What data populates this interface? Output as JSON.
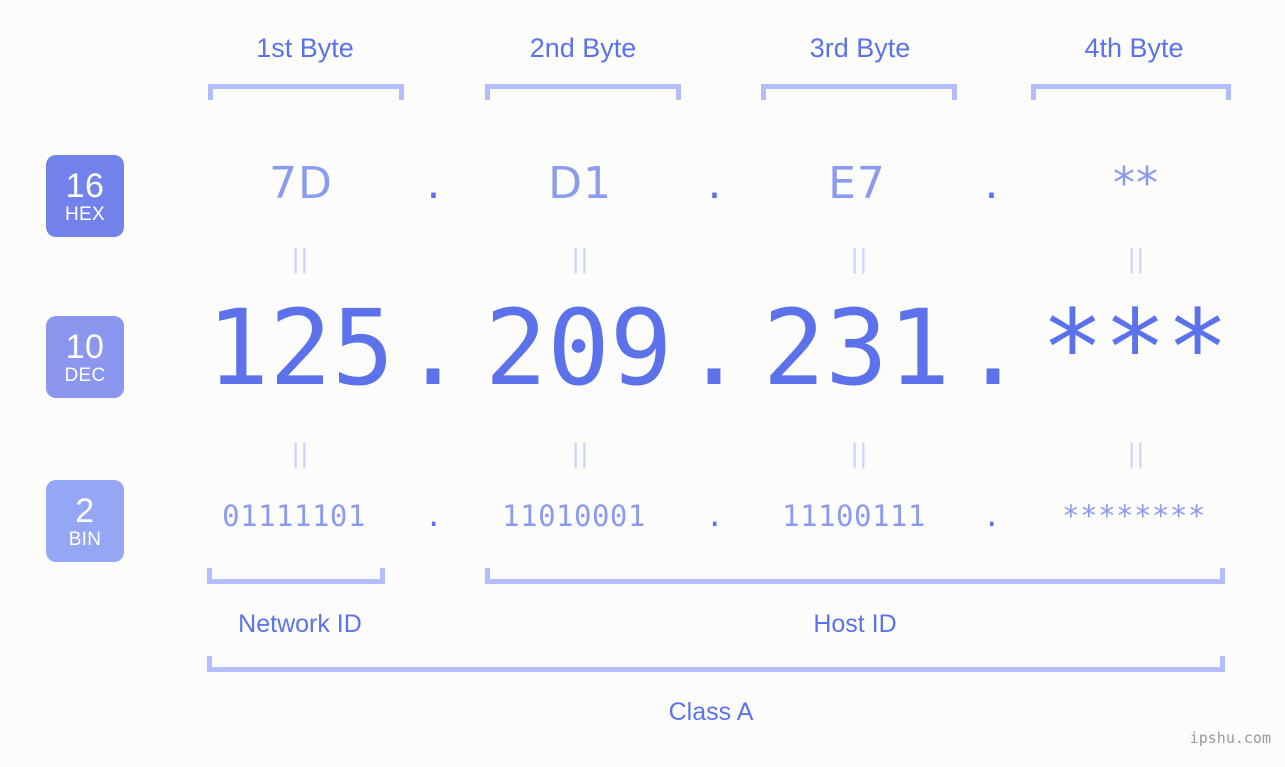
{
  "meta": {
    "watermark": "ipshu.com",
    "background_color": "#fcfdfa",
    "accent_color": "#5b72ea",
    "accent_light_color": "#8b9bf0",
    "bracket_color": "#b3bdfb",
    "separator_color": "#ccd3fb"
  },
  "headers": {
    "bytes": [
      {
        "label": "1st Byte"
      },
      {
        "label": "2nd Byte"
      },
      {
        "label": "3rd Byte"
      },
      {
        "label": "4th Byte"
      }
    ]
  },
  "bases": [
    {
      "number": "16",
      "abbr": "HEX",
      "color": "#7382eb"
    },
    {
      "number": "10",
      "abbr": "DEC",
      "color": "#8b97ef"
    },
    {
      "number": "2",
      "abbr": "BIN",
      "color": "#95a6f5"
    }
  ],
  "rows": {
    "hex": {
      "base_number": "16",
      "base_abbr": "HEX",
      "values": [
        "7D",
        "D1",
        "E7",
        "**"
      ],
      "separators": [
        ".",
        ".",
        "."
      ]
    },
    "dec": {
      "base_number": "10",
      "base_abbr": "DEC",
      "values": [
        "125",
        "209",
        "231",
        "***"
      ],
      "separators": [
        ".",
        ".",
        "."
      ]
    },
    "bin": {
      "base_number": "2",
      "base_abbr": "BIN",
      "values": [
        "01111101",
        "11010001",
        "11100111",
        "********"
      ],
      "separators": [
        ".",
        ".",
        "."
      ]
    }
  },
  "equality_marks": {
    "symbol": "||",
    "hex_to_dec": [
      "||",
      "||",
      "||",
      "||"
    ],
    "dec_to_bin": [
      "||",
      "||",
      "||",
      "||"
    ]
  },
  "sections": {
    "network_id": {
      "label": "Network ID"
    },
    "host_id": {
      "label": "Host ID"
    },
    "class": {
      "label": "Class A"
    }
  }
}
